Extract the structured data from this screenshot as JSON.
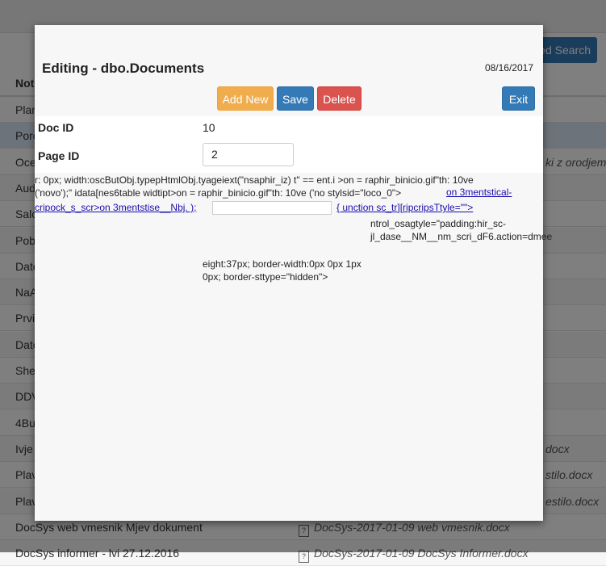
{
  "background": {
    "search_button_label": "ed Search",
    "column_header": "Note",
    "rows": [
      {
        "c1": "Plan",
        "c2": "",
        "c3": ""
      },
      {
        "c1": "Porc",
        "c2": "",
        "c3": ""
      },
      {
        "c1": "Oce",
        "c2": "",
        "c3": "ki z orodjem S"
      },
      {
        "c1": "Aud",
        "c2": "",
        "c3": ""
      },
      {
        "c1": "Salo",
        "c2": "",
        "c3": ""
      },
      {
        "c1": "Pob",
        "c2": "",
        "c3": ""
      },
      {
        "c1": "Date",
        "c2": "",
        "c3": ""
      },
      {
        "c1": "NaA",
        "c2": "",
        "c3": ""
      },
      {
        "c1": "Prvi",
        "c2": "",
        "c3": ""
      },
      {
        "c1": "Date",
        "c2": "",
        "c3": ""
      },
      {
        "c1": "She",
        "c2": "",
        "c3": ""
      },
      {
        "c1": "DDV",
        "c2": "",
        "c3": ""
      },
      {
        "c1": "4Bu",
        "c2": "",
        "c3": ""
      },
      {
        "c1": "Ivje",
        "c2": "",
        "c3": "docx"
      },
      {
        "c1": "Plav",
        "c2": "",
        "c3": "stilo.docx"
      },
      {
        "c1": "Plav",
        "c2": "",
        "c3": "estilo.docx"
      },
      {
        "c1": "DocSys web vmesnik Mjev dokument",
        "c2": "DocSys-2017-01-09 web vmesnik.docx",
        "c3": ""
      },
      {
        "c1": "DocSys informer - lvi 27.12.2016",
        "c2": "DocSys-2017-01-09 DocSys Informer.docx",
        "c3": ""
      }
    ]
  },
  "modal": {
    "title": "Editing - dbo.Documents",
    "date": "08/16/2017",
    "buttons": {
      "add_new": "Add New",
      "save": "Save",
      "delete": "Delete",
      "exit": "Exit"
    },
    "fields": {
      "doc_id_label": "Doc ID",
      "doc_id_value": "10",
      "page_id_label": "Page ID",
      "page_id_value": "2"
    },
    "raw_markup": {
      "line1": "r: 0px; width:oscButObj.typepHtmlObj.tyageiext(\"nsaphir_iz) t\" == ent.i >on = raphir_binicio.gif\"th: 10ve",
      "line2_text": "('novo');\" idata[nes6table widtipt>on = raphir_binicio.gif\"th: 10ve ('no stylsid=\"loco_0\">",
      "line2_link": "on 3mentstical-",
      "line3_link": "cripock_s_scr>on 3mentstise__Nbj. );",
      "line3_link2": "{ unction sc_tr][ripcripsTtyle=\"\">",
      "block_right": "ntrol_osagtyle=\"padding:hir_sc-jl_dase__NM__nm_scri_dF6.action=dmee",
      "block_mid": "eight:37px; border-width:0px 0px 1px 0px; border-sttype=\"hidden\">"
    }
  }
}
